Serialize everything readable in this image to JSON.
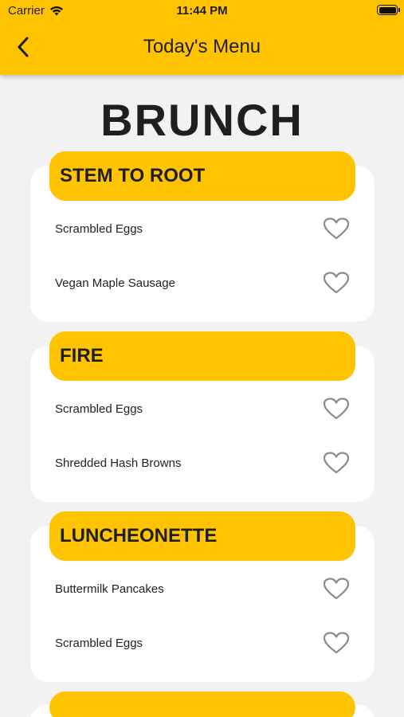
{
  "status_bar": {
    "carrier": "Carrier",
    "time": "11:44 PM"
  },
  "nav": {
    "title": "Today's Menu",
    "back_icon": "chevron-left-icon"
  },
  "page": {
    "heading": "BRUNCH"
  },
  "sections": [
    {
      "title": "STEM TO ROOT",
      "items": [
        {
          "name": "Scrambled Eggs",
          "favorited": false
        },
        {
          "name": "Vegan Maple Sausage",
          "favorited": false
        }
      ]
    },
    {
      "title": "FIRE",
      "items": [
        {
          "name": "Scrambled Eggs",
          "favorited": false
        },
        {
          "name": "Shredded Hash Browns",
          "favorited": false
        }
      ]
    },
    {
      "title": "LUNCHEONETTE",
      "items": [
        {
          "name": "Buttermilk Pancakes",
          "favorited": false
        },
        {
          "name": "Scrambled Eggs",
          "favorited": false
        }
      ]
    }
  ],
  "colors": {
    "accent": "#ffc300",
    "background": "#f2f2f2",
    "card": "#ffffff",
    "icon": "#8a8a8a"
  }
}
